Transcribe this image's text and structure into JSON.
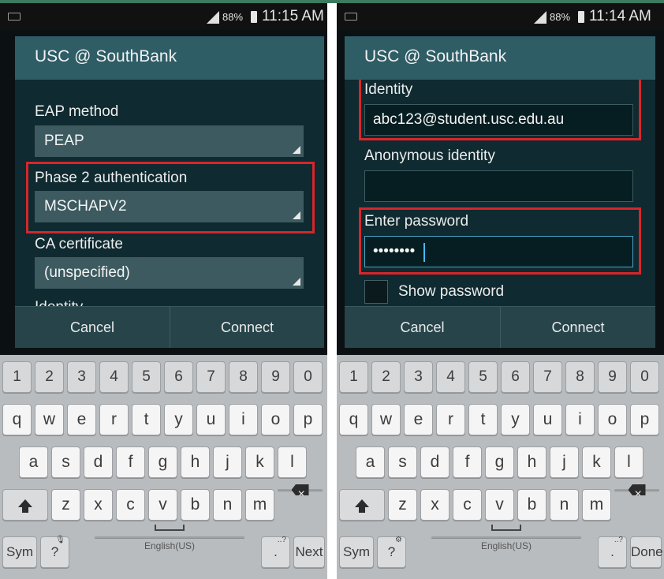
{
  "colors": {
    "highlight": "#d6262b",
    "dialog_title_bg": "#2e5d66",
    "dialog_bg": "#0f2a30",
    "keyboard_bg": "#b9bcbf",
    "focus_border": "#4aa9c9"
  },
  "left": {
    "status": {
      "battery": "88%",
      "time": "11:15 AM"
    },
    "dialog": {
      "title": "USC @ SouthBank",
      "eap_label": "EAP method",
      "eap_value": "PEAP",
      "phase2_label": "Phase 2 authentication",
      "phase2_value": "MSCHAPV2",
      "ca_label": "CA certificate",
      "ca_value": "(unspecified)",
      "identity_partial": "Identity",
      "cancel": "Cancel",
      "connect": "Connect"
    },
    "keyboard": {
      "sym": "Sym",
      "space": "English(US)",
      "period": ".",
      "action": "Next"
    }
  },
  "right": {
    "status": {
      "battery": "88%",
      "time": "11:14 AM"
    },
    "dialog": {
      "title": "USC @ SouthBank",
      "identity_label": "Identity",
      "identity_value": "abc123@student.usc.edu.au",
      "anon_label": "Anonymous identity",
      "anon_value": "",
      "password_label": "Enter password",
      "password_value": "••••••••",
      "show_password": "Show password",
      "cancel": "Cancel",
      "connect": "Connect"
    },
    "keyboard": {
      "sym": "Sym",
      "space": "English(US)",
      "period": ".",
      "action": "Done"
    }
  },
  "keys": {
    "numbers": [
      "1",
      "2",
      "3",
      "4",
      "5",
      "6",
      "7",
      "8",
      "9",
      "0"
    ],
    "row1": [
      "q",
      "w",
      "e",
      "r",
      "t",
      "y",
      "u",
      "i",
      "o",
      "p"
    ],
    "row2": [
      "a",
      "s",
      "d",
      "f",
      "g",
      "h",
      "j",
      "k",
      "l"
    ],
    "row3": [
      "z",
      "x",
      "c",
      "v",
      "b",
      "n",
      "m"
    ],
    "question": "?",
    "question_sup": "..?"
  }
}
